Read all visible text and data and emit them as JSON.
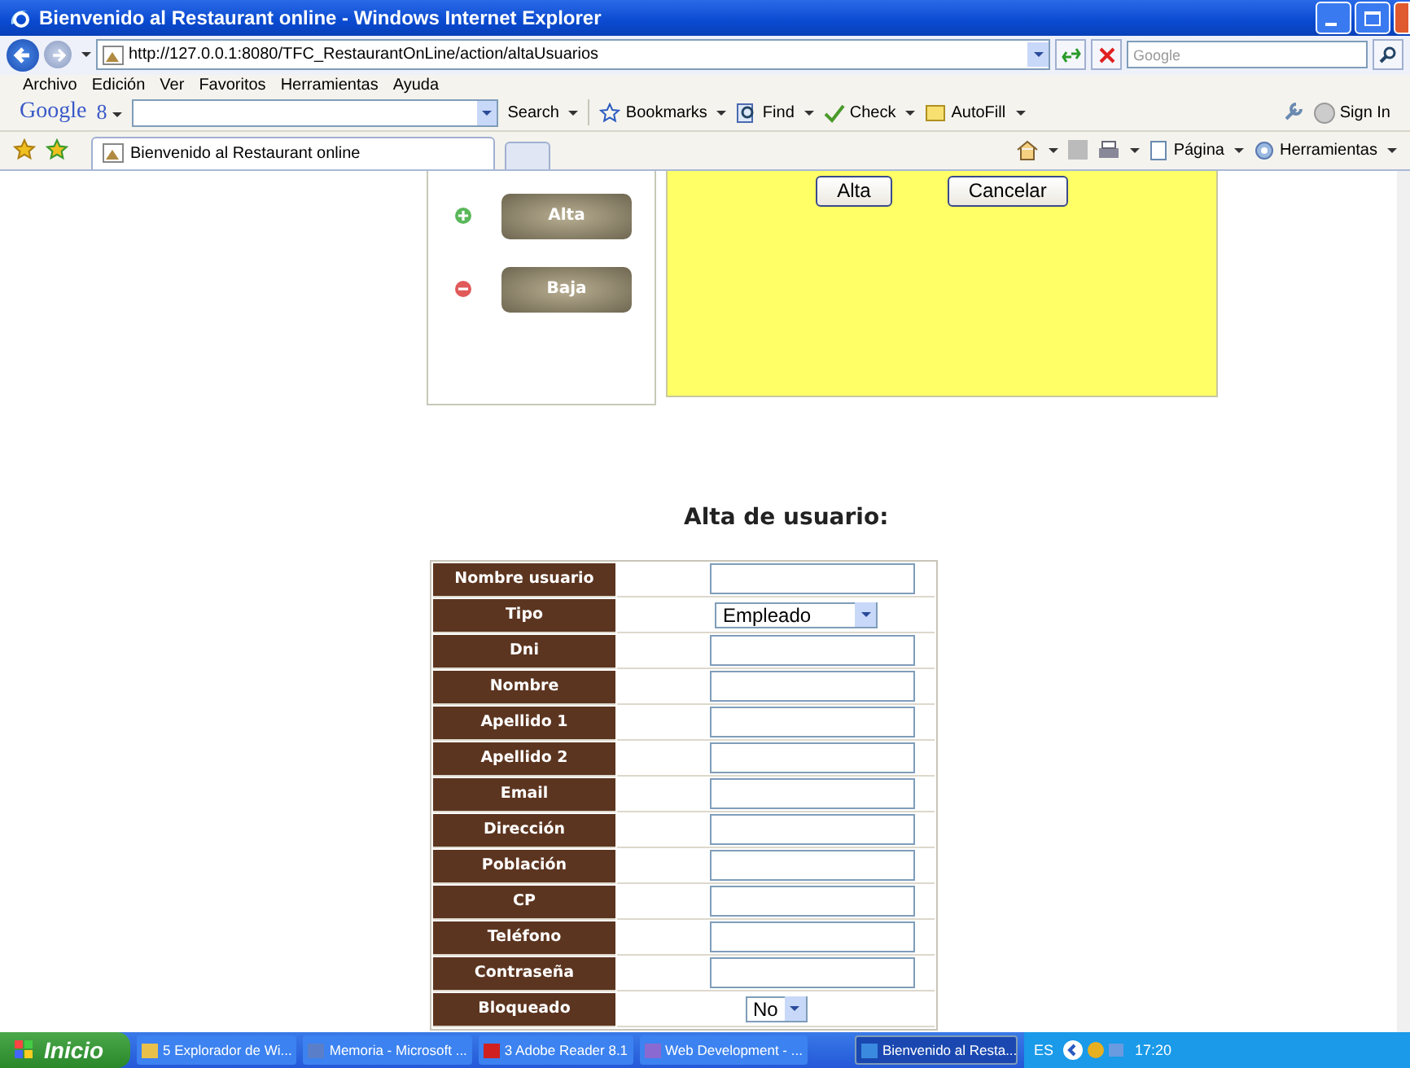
{
  "window": {
    "title": "Bienvenido al Restaurant online - Windows Internet Explorer"
  },
  "address": {
    "url": "http://127.0.0.1:8080/TFC_RestaurantOnLine/action/altaUsuarios",
    "search_placeholder": "Google"
  },
  "menu": [
    "Archivo",
    "Edición",
    "Ver",
    "Favoritos",
    "Herramientas",
    "Ayuda"
  ],
  "google_toolbar": {
    "logo": "Google",
    "logo_suffix": "8",
    "items": [
      {
        "label": "Search",
        "kind": "search"
      },
      {
        "label": "Bookmarks",
        "kind": "star"
      },
      {
        "label": "Find",
        "kind": "find"
      },
      {
        "label": "Check",
        "kind": "check"
      },
      {
        "label": "AutoFill",
        "kind": "autofill"
      }
    ],
    "sign_in": "Sign In"
  },
  "tab": {
    "title": "Bienvenido al Restaurant online"
  },
  "command_bar": [
    "Página",
    "Herramientas"
  ],
  "side_menu": [
    {
      "label": "Alta",
      "kind": "add"
    },
    {
      "label": "Baja",
      "kind": "remove"
    }
  ],
  "panel_buttons": [
    "Alta",
    "Cancelar"
  ],
  "heading": "Alta de usuario:",
  "form": [
    {
      "label": "Nombre usuario",
      "kind": "text"
    },
    {
      "label": "Tipo",
      "kind": "select",
      "value": "Empleado"
    },
    {
      "label": "Dni",
      "kind": "text"
    },
    {
      "label": "Nombre",
      "kind": "text"
    },
    {
      "label": "Apellido 1",
      "kind": "text"
    },
    {
      "label": "Apellido 2",
      "kind": "text"
    },
    {
      "label": "Email",
      "kind": "text"
    },
    {
      "label": "Dirección",
      "kind": "text"
    },
    {
      "label": "Población",
      "kind": "text"
    },
    {
      "label": "CP",
      "kind": "text"
    },
    {
      "label": "Teléfono",
      "kind": "text"
    },
    {
      "label": "Contraseña",
      "kind": "text"
    },
    {
      "label": "Bloqueado",
      "kind": "select",
      "value": "No"
    }
  ],
  "taskbar": {
    "start": "Inicio",
    "tasks": [
      {
        "label": "5 Explorador de Wi...",
        "kind": "folder",
        "selected": false
      },
      {
        "label": "Memoria - Microsoft ...",
        "kind": "doc",
        "selected": false
      },
      {
        "label": "3 Adobe Reader 8.1",
        "kind": "pdf",
        "selected": false
      },
      {
        "label": "Web Development - ...",
        "kind": "web",
        "selected": false
      },
      {
        "label": "Bienvenido al Resta...",
        "kind": "ie",
        "selected": true
      }
    ],
    "language": "ES",
    "clock": "17:20"
  }
}
